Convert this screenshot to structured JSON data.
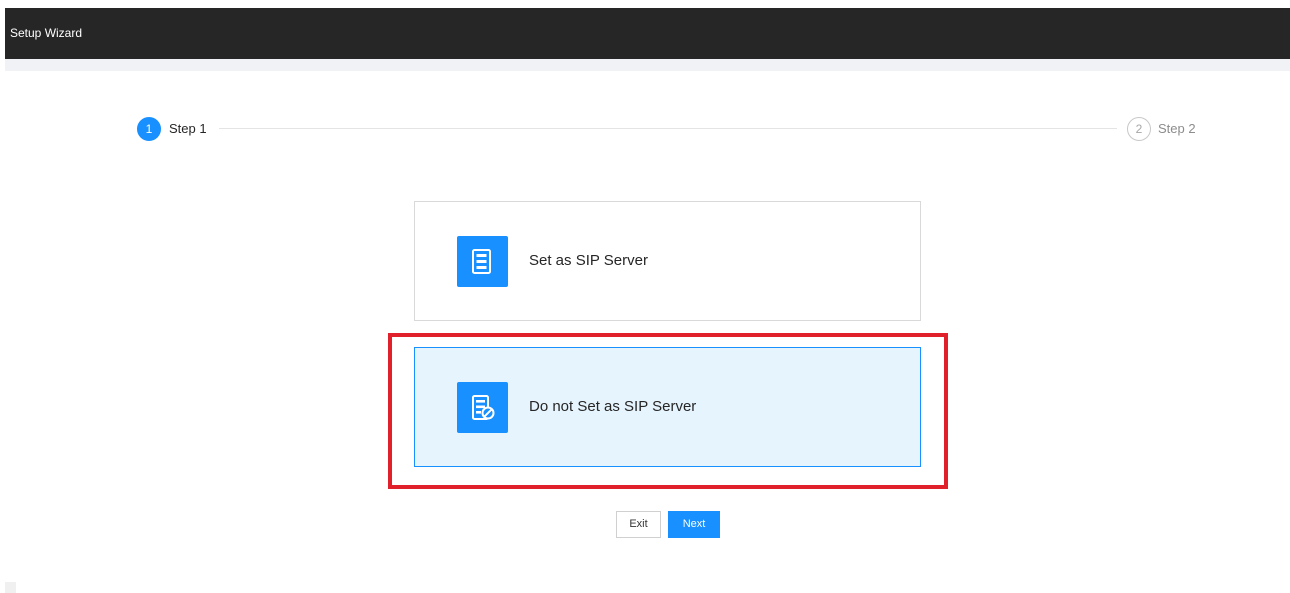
{
  "window": {
    "title": "Setup Wizard"
  },
  "steps": [
    {
      "number": "1",
      "label": "Step 1",
      "state": "active"
    },
    {
      "number": "2",
      "label": "Step 2",
      "state": "inactive"
    }
  ],
  "options": [
    {
      "label": "Set as SIP Server",
      "icon": "server-icon",
      "selected": false
    },
    {
      "label": "Do not Set as SIP Server",
      "icon": "server-disabled-icon",
      "selected": true
    }
  ],
  "buttons": {
    "exit_label": "Exit",
    "next_label": "Next"
  },
  "colors": {
    "accent": "#1890ff",
    "titlebar": "#262626",
    "selected_bg": "#e6f4fd",
    "highlight": "#e0202a"
  }
}
